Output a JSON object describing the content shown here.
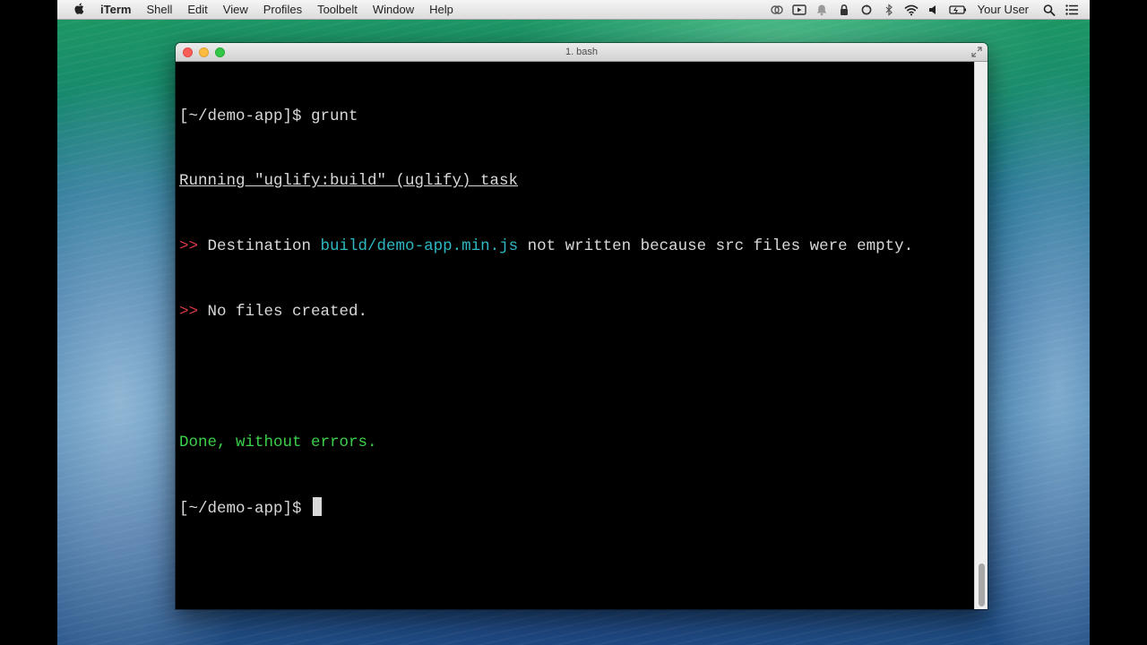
{
  "menubar": {
    "app_name": "iTerm",
    "menus": [
      "Shell",
      "Edit",
      "View",
      "Profiles",
      "Toolbelt",
      "Window",
      "Help"
    ],
    "user": "Your User",
    "status_icons": [
      "creative-cloud-icon",
      "screen-recorder-icon",
      "notification-icon",
      "lock-icon",
      "sync-icon",
      "bluetooth-icon",
      "wifi-icon",
      "volume-icon",
      "battery-icon"
    ]
  },
  "window": {
    "title": "1. bash"
  },
  "terminal": {
    "prompt": "[~/demo-app]$ ",
    "command": "grunt",
    "task_line": "Running \"uglify:build\" (uglify) task",
    "marker": ">>",
    "dest_prefix": " Destination ",
    "dest_file": "build/demo-app.min.js",
    "dest_suffix": " not written because src files were empty.",
    "no_files": " No files created.",
    "done": "Done, without errors."
  },
  "colors": {
    "error_marker": "#e0394a",
    "file_path": "#2fb8c4",
    "success": "#3bd14a"
  }
}
